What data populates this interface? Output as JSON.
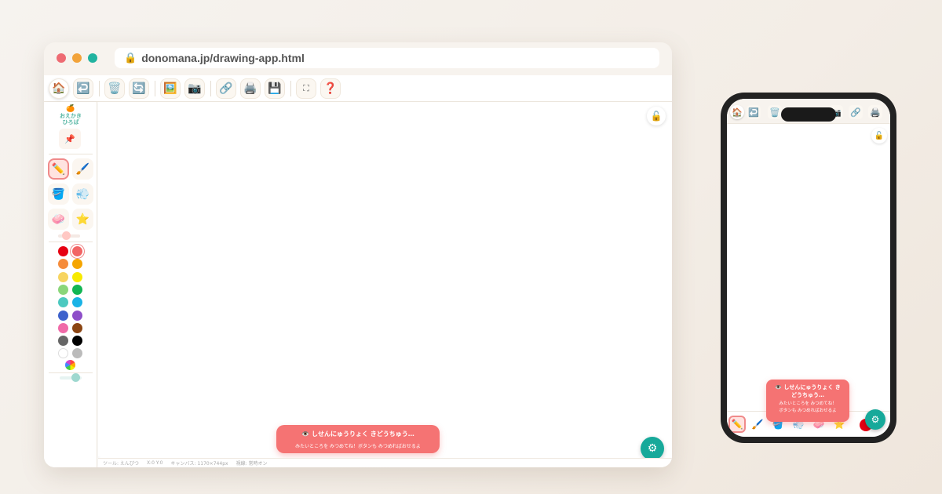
{
  "browser": {
    "url": "donomana.jp/drawing-app.html"
  },
  "toolbar": {
    "buttons": [
      {
        "name": "home",
        "glyph": "🏠"
      },
      {
        "name": "undo",
        "glyph": "↩️"
      },
      {
        "name": "clear",
        "glyph": "🗑️"
      },
      {
        "name": "redo",
        "glyph": "🔄"
      },
      {
        "name": "image",
        "glyph": "🖼️"
      },
      {
        "name": "camera",
        "glyph": "📷"
      },
      {
        "name": "share",
        "glyph": "🔗"
      },
      {
        "name": "print",
        "glyph": "🖨️"
      },
      {
        "name": "save",
        "glyph": "💾"
      },
      {
        "name": "fullscreen",
        "glyph": "⛶"
      },
      {
        "name": "help",
        "glyph": "❓"
      }
    ]
  },
  "sidebar": {
    "logo_text": "おえかき\nひろば",
    "tools": [
      {
        "name": "pencil",
        "glyph": "✏️",
        "active": true
      },
      {
        "name": "brush",
        "glyph": "🖌️",
        "active": false
      },
      {
        "name": "bucket",
        "glyph": "🪣",
        "active": false
      },
      {
        "name": "spray",
        "glyph": "💨",
        "active": false
      },
      {
        "name": "eraser",
        "glyph": "🧼",
        "active": false
      },
      {
        "name": "stamp",
        "glyph": "⭐",
        "active": false
      }
    ],
    "colors": [
      "#e60012",
      "#f26464",
      "#f58c3c",
      "#f5a500",
      "#f7d460",
      "#f7ea00",
      "#8ad67a",
      "#12b654",
      "#4cc9c0",
      "#1ab3e6",
      "#3d62cc",
      "#8e4fc9",
      "#f06aa8",
      "#8b4513",
      "#666666",
      "#000000",
      "#ffffff",
      "#bbbbbb"
    ],
    "selected_color": "#f26464"
  },
  "toast": {
    "title": "👁️ しせんにゅうりょく きどうちゅう…",
    "message": "みたいところを みつめてね！ボタンも みつめればおせるよ"
  },
  "status": {
    "tool": "ツール: えんぴつ",
    "coords": "X:0 Y:0",
    "canvas": "キャンバス: 1170×744px",
    "gaze": "視線: 常時オン"
  },
  "phone": {
    "toast_title": "👁️ しせんにゅうりょく き\nどうちゅう…",
    "toast_line1": "みたいところを みつめてね！",
    "toast_line2": "ボタンも みつめればおせるよ"
  },
  "icons": {
    "lock": "🔒",
    "unlock": "🔓",
    "pin": "📌",
    "gear": "⚙",
    "logo_drop": "🍊"
  }
}
